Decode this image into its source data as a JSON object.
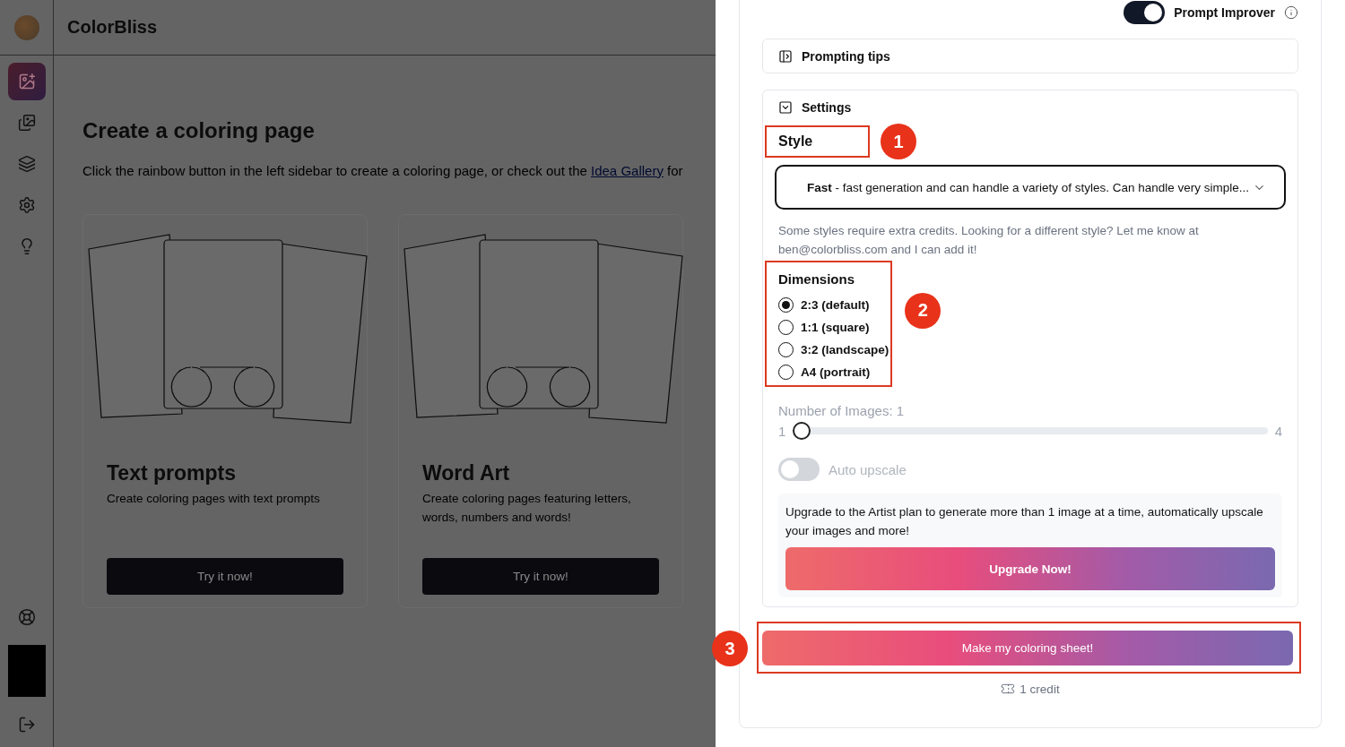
{
  "app": {
    "name": "ColorBliss",
    "sidebar": {
      "items": [
        {
          "selected": true
        },
        {
          "selected": false
        },
        {
          "selected": false
        },
        {
          "selected": false
        },
        {
          "selected": false
        }
      ]
    }
  },
  "page": {
    "title": "Create a coloring page",
    "intro": "Click the rainbow button in the left sidebar to create a coloring page, or check out the",
    "link": "Idea Gallery",
    "intro_after": "for",
    "cards": [
      {
        "title": "Text prompts",
        "description": "Create coloring pages with text prompts",
        "button": "Try it now!"
      },
      {
        "title": "Word Art",
        "description": "Create coloring pages featuring letters, words, numbers and words!",
        "button": "Try it now!"
      }
    ]
  },
  "panel": {
    "prompt_improver": {
      "label": "Prompt Improver",
      "on": true
    },
    "prompting_tips": {
      "label": "Prompting tips"
    },
    "settings": {
      "label": "Settings",
      "style": {
        "label": "Style",
        "value": "**Fast** - fast generation and can handle a variety of styles. Can handle very simple...",
        "note": "Some styles require extra credits. Looking for a different style? Let me know at ben@colorbliss.com and I can add it!"
      },
      "dimensions": {
        "label": "Dimensions",
        "options": [
          {
            "label": "2:3 (default)",
            "selected": true
          },
          {
            "label": "1:1 (square)",
            "selected": false
          },
          {
            "label": "3:2 (landscape)",
            "selected": false
          },
          {
            "label": "A4 (portrait)",
            "selected": false
          }
        ]
      },
      "images": {
        "label": "Number of Images: 1",
        "min": "1",
        "max": "4",
        "level": 0,
        "disabled": true
      },
      "auto_upscale": {
        "label": "Auto upscale",
        "on": false,
        "disabled": true
      },
      "upgrade": {
        "text": "Upgrade to the Artist plan to generate more than 1 image at a time, automatically upscale your images and more!",
        "button": "Upgrade Now!"
      }
    },
    "submit": {
      "label": "Make my coloring sheet!",
      "cost": "1 credit"
    }
  },
  "annotations": [
    {
      "number": "1"
    },
    {
      "number": "2"
    },
    {
      "number": "3"
    }
  ]
}
